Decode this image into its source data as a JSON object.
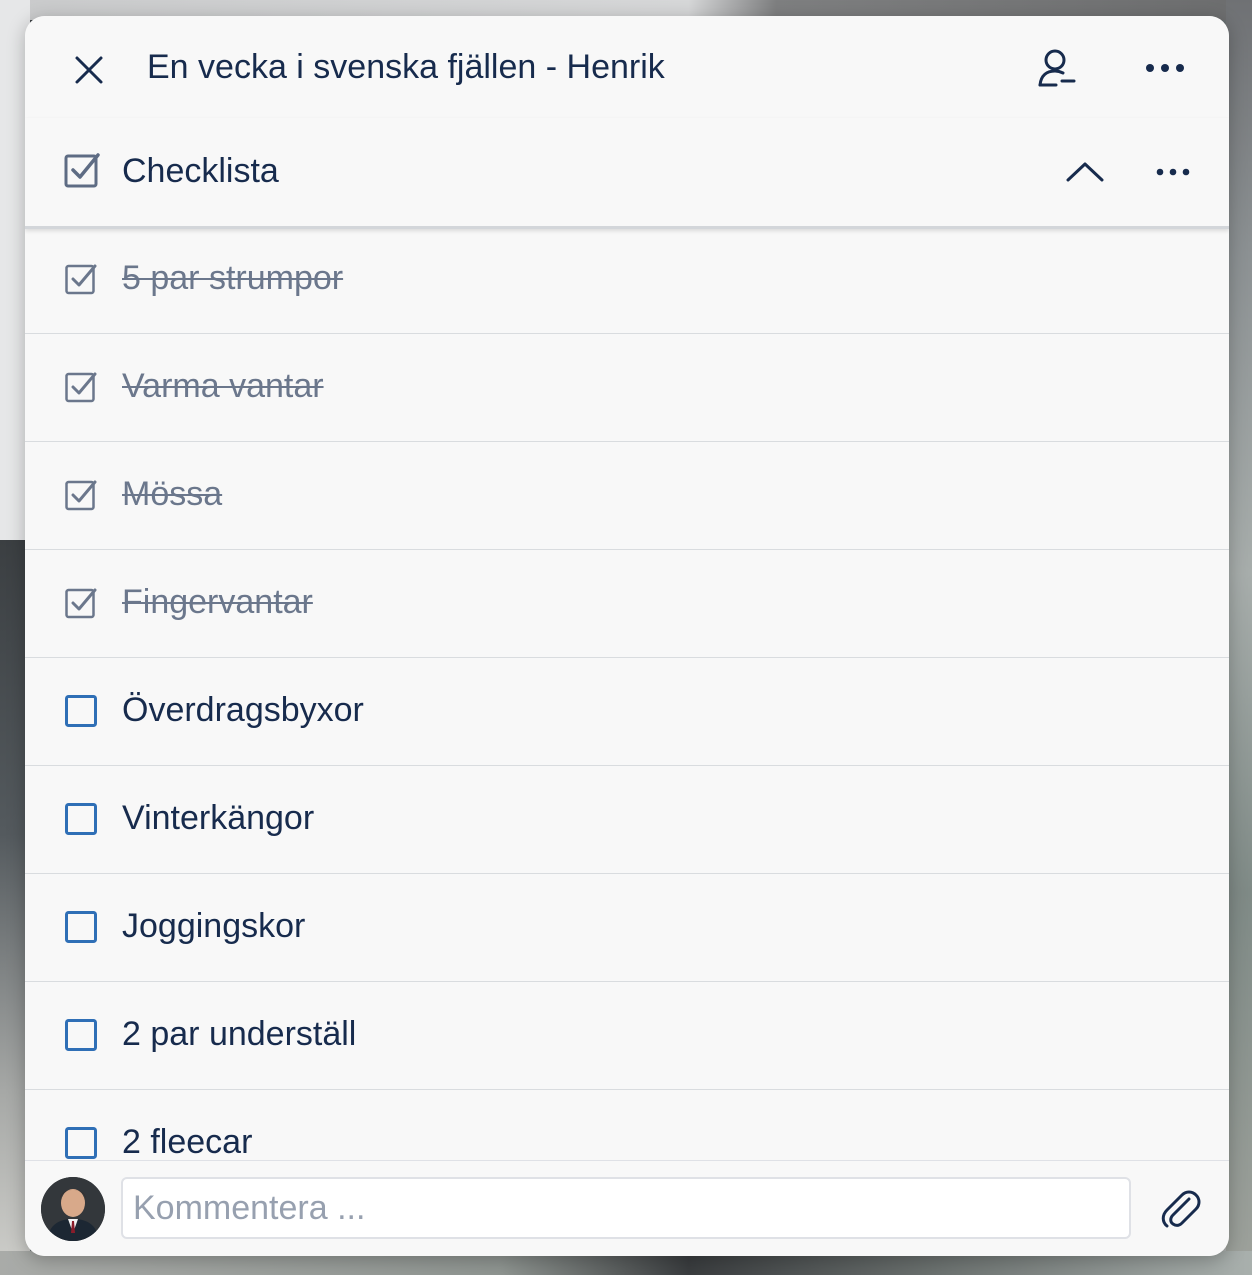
{
  "card": {
    "title": "En vecka i svenska fjällen - Henrik"
  },
  "header_icons": {
    "close": "close-icon",
    "member": "member-icon",
    "more": "more-horizontal-icon"
  },
  "checklist": {
    "title": "Checklista",
    "icon": "checklist-icon",
    "collapse_icon": "chevron-up-icon",
    "more_icon": "more-horizontal-icon",
    "items": [
      {
        "label": "5 par strumpor",
        "checked": true
      },
      {
        "label": "Varma vantar",
        "checked": true
      },
      {
        "label": "Mössa",
        "checked": true
      },
      {
        "label": "Fingervantar",
        "checked": true
      },
      {
        "label": "Överdragsbyxor",
        "checked": false
      },
      {
        "label": "Vinterkängor",
        "checked": false
      },
      {
        "label": "Joggingskor",
        "checked": false
      },
      {
        "label": "2 par underställ",
        "checked": false
      },
      {
        "label": "2 fleecar",
        "checked": false
      }
    ]
  },
  "composer": {
    "placeholder": "Kommentera ...",
    "value": "",
    "attach_icon": "paperclip-icon",
    "avatar_icon": "user-avatar"
  },
  "colors": {
    "title_text": "#172b4d",
    "checked_text": "#6b778c",
    "unchecked_box": "#2f6fb6",
    "checked_box": "#6b778c",
    "modal_bg": "#f8f8f8"
  }
}
